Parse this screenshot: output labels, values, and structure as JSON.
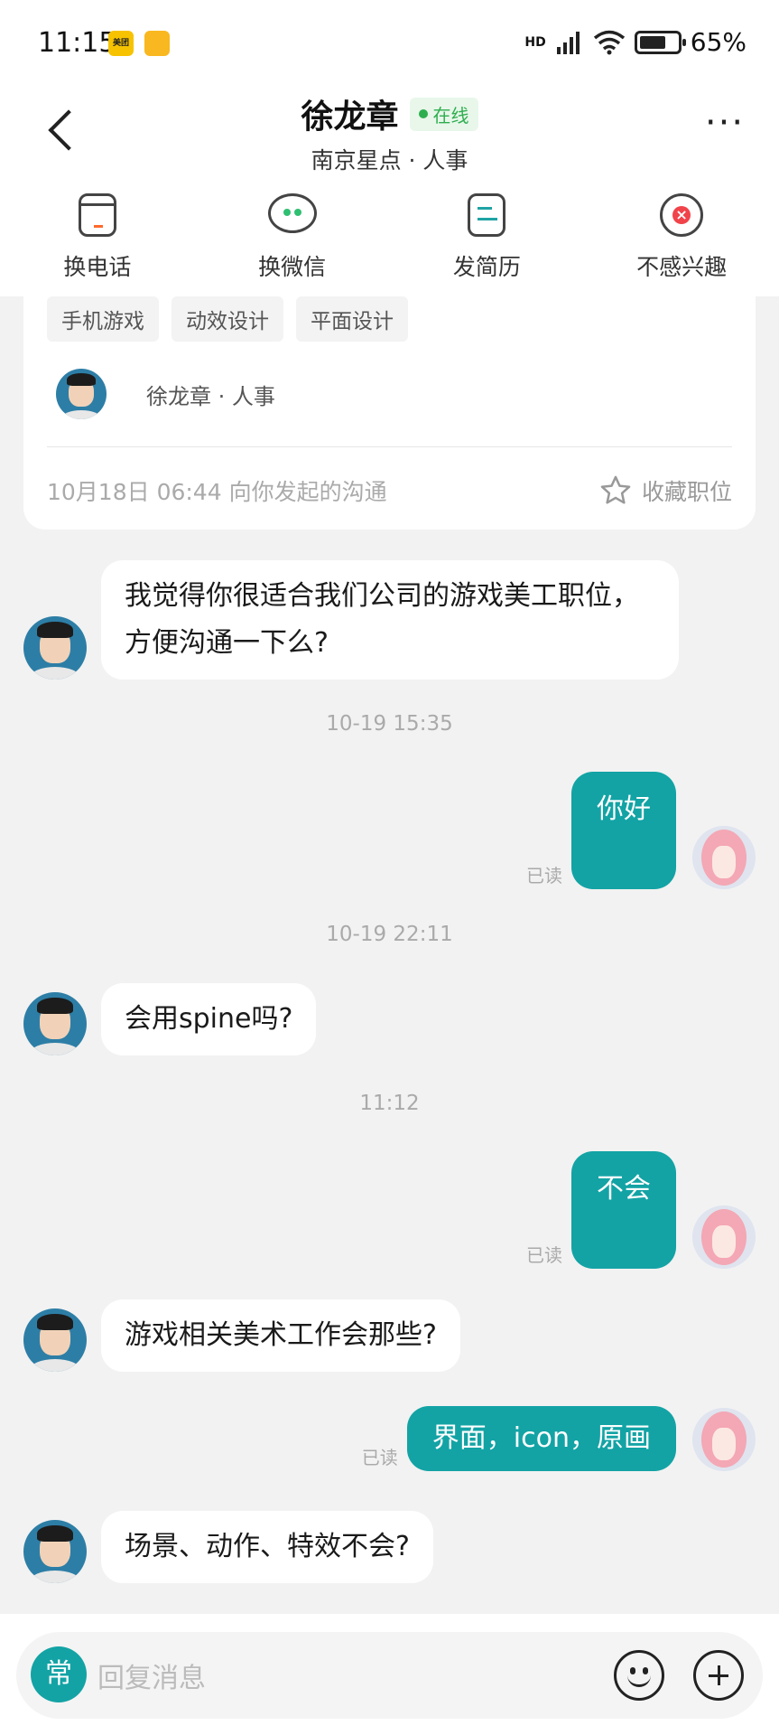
{
  "status_bar": {
    "time": "11:15",
    "app1_label": "美团",
    "network": "HD",
    "battery": "65%"
  },
  "header": {
    "name": "徐龙章",
    "online": "在线",
    "subtitle": "南京星点 · 人事",
    "more": "···"
  },
  "actions": [
    {
      "label": "换电话",
      "icon": "phone-icon"
    },
    {
      "label": "换微信",
      "icon": "wechat-icon"
    },
    {
      "label": "发简历",
      "icon": "resume-icon"
    },
    {
      "label": "不感兴趣",
      "icon": "not-interested-icon"
    }
  ],
  "job_card": {
    "tags": [
      "手机游戏",
      "动效设计",
      "平面设计"
    ],
    "recruiter": "徐龙章 · 人事",
    "note": "10月18日 06:44 向你发起的沟通",
    "favorite": "收藏职位"
  },
  "messages": {
    "m1": "我觉得你很适合我们公司的游戏美工职位，方便沟通一下么?",
    "t1": "10-19 15:35",
    "m2": "你好",
    "m2_read": "已读",
    "t2": "10-19 22:11",
    "m3": "会用spine吗?",
    "t3": "11:12",
    "m4": "不会",
    "m4_read": "已读",
    "m5": "游戏相关美术工作会那些?",
    "m6": "界面，icon，原画",
    "m6_read": "已读",
    "m7": "场景、动作、特效不会?"
  },
  "input": {
    "quick": "常",
    "placeholder": "回复消息"
  },
  "colors": {
    "accent": "#13a3a5",
    "online": "#2fae4f",
    "danger": "#f1434a"
  }
}
